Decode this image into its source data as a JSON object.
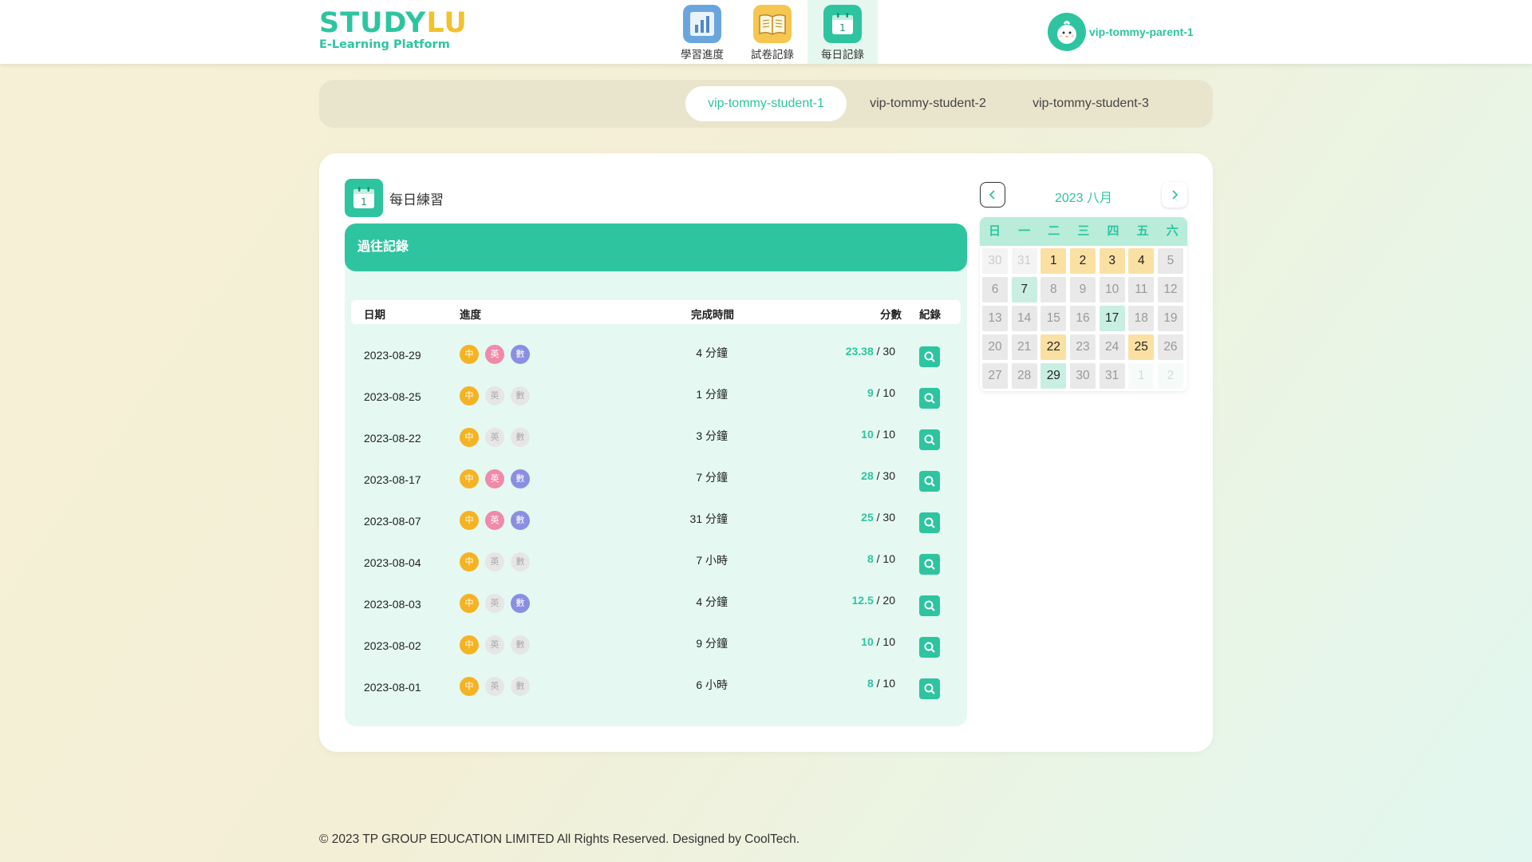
{
  "brand": {
    "logo_main": "STUDY",
    "logo_accent": "LU",
    "logo_sub": "E-Learning Platform"
  },
  "nav": [
    {
      "label": "學習進度",
      "icon": "chart-icon",
      "active": false
    },
    {
      "label": "試卷記錄",
      "icon": "book-icon",
      "active": false
    },
    {
      "label": "每日記錄",
      "icon": "calendar-icon",
      "active": true
    }
  ],
  "user": {
    "name": "vip-tommy-parent-1"
  },
  "students": [
    {
      "label": "vip-tommy-student-1",
      "active": true
    },
    {
      "label": "vip-tommy-student-2",
      "active": false
    },
    {
      "label": "vip-tommy-student-3",
      "active": false
    }
  ],
  "section": {
    "title": "每日練習",
    "icon_number": "1",
    "records_header": "過往記錄"
  },
  "table": {
    "columns": {
      "date": "日期",
      "progress": "進度",
      "time": "完成時間",
      "score": "分數",
      "record": "紀錄"
    },
    "subjects": {
      "zh": "中",
      "en": "英",
      "ma": "數"
    },
    "rows": [
      {
        "date": "2023-08-29",
        "en": true,
        "ma": true,
        "time": "4 分鐘",
        "score": "23.38",
        "total": " / 30"
      },
      {
        "date": "2023-08-25",
        "en": false,
        "ma": false,
        "time": "1 分鐘",
        "score": "9",
        "total": " / 10"
      },
      {
        "date": "2023-08-22",
        "en": false,
        "ma": false,
        "time": "3 分鐘",
        "score": "10",
        "total": " / 10"
      },
      {
        "date": "2023-08-17",
        "en": true,
        "ma": true,
        "time": "7 分鐘",
        "score": "28",
        "total": " / 30"
      },
      {
        "date": "2023-08-07",
        "en": true,
        "ma": true,
        "time": "31 分鐘",
        "score": "25",
        "total": " / 30"
      },
      {
        "date": "2023-08-04",
        "en": false,
        "ma": false,
        "time": "7 小時",
        "score": "8",
        "total": " / 10"
      },
      {
        "date": "2023-08-03",
        "en": false,
        "ma": true,
        "time": "4 分鐘",
        "score": "12.5",
        "total": " / 20"
      },
      {
        "date": "2023-08-02",
        "en": false,
        "ma": false,
        "time": "9 分鐘",
        "score": "10",
        "total": " / 10"
      },
      {
        "date": "2023-08-01",
        "en": false,
        "ma": false,
        "time": "6 小時",
        "score": "8",
        "total": " / 10"
      }
    ]
  },
  "calendar": {
    "title": "2023 八月",
    "weekdays": [
      "日",
      "一",
      "二",
      "三",
      "四",
      "五",
      "六"
    ],
    "days": [
      {
        "d": "30",
        "s": "out"
      },
      {
        "d": "31",
        "s": "out"
      },
      {
        "d": "1",
        "s": "done"
      },
      {
        "d": "2",
        "s": "done"
      },
      {
        "d": "3",
        "s": "done"
      },
      {
        "d": "4",
        "s": "done"
      },
      {
        "d": "5",
        "s": "none"
      },
      {
        "d": "6",
        "s": "none"
      },
      {
        "d": "7",
        "s": "part"
      },
      {
        "d": "8",
        "s": "none"
      },
      {
        "d": "9",
        "s": "none"
      },
      {
        "d": "10",
        "s": "none"
      },
      {
        "d": "11",
        "s": "none"
      },
      {
        "d": "12",
        "s": "none"
      },
      {
        "d": "13",
        "s": "none"
      },
      {
        "d": "14",
        "s": "none"
      },
      {
        "d": "15",
        "s": "none"
      },
      {
        "d": "16",
        "s": "none"
      },
      {
        "d": "17",
        "s": "part"
      },
      {
        "d": "18",
        "s": "none"
      },
      {
        "d": "19",
        "s": "none"
      },
      {
        "d": "20",
        "s": "none"
      },
      {
        "d": "21",
        "s": "none"
      },
      {
        "d": "22",
        "s": "done"
      },
      {
        "d": "23",
        "s": "none"
      },
      {
        "d": "24",
        "s": "none"
      },
      {
        "d": "25",
        "s": "done"
      },
      {
        "d": "26",
        "s": "none"
      },
      {
        "d": "27",
        "s": "none"
      },
      {
        "d": "28",
        "s": "none"
      },
      {
        "d": "29",
        "s": "part"
      },
      {
        "d": "30",
        "s": "none"
      },
      {
        "d": "31",
        "s": "none"
      },
      {
        "d": "1",
        "s": "outnext"
      },
      {
        "d": "2",
        "s": "outnext"
      }
    ]
  },
  "footer": {
    "text": "© 2023 TP GROUP EDUCATION LIMITED All Rights Reserved. Designed by CoolTech."
  },
  "colors": {
    "accent": "#2ec4a0",
    "logo_accent": "#f2c12e",
    "subject_zh": "#f5b323",
    "subject_en": "#f08aa8",
    "subject_ma": "#8b8fe2",
    "day_done": "#fbe0a4",
    "day_partial": "#c9efe2"
  }
}
